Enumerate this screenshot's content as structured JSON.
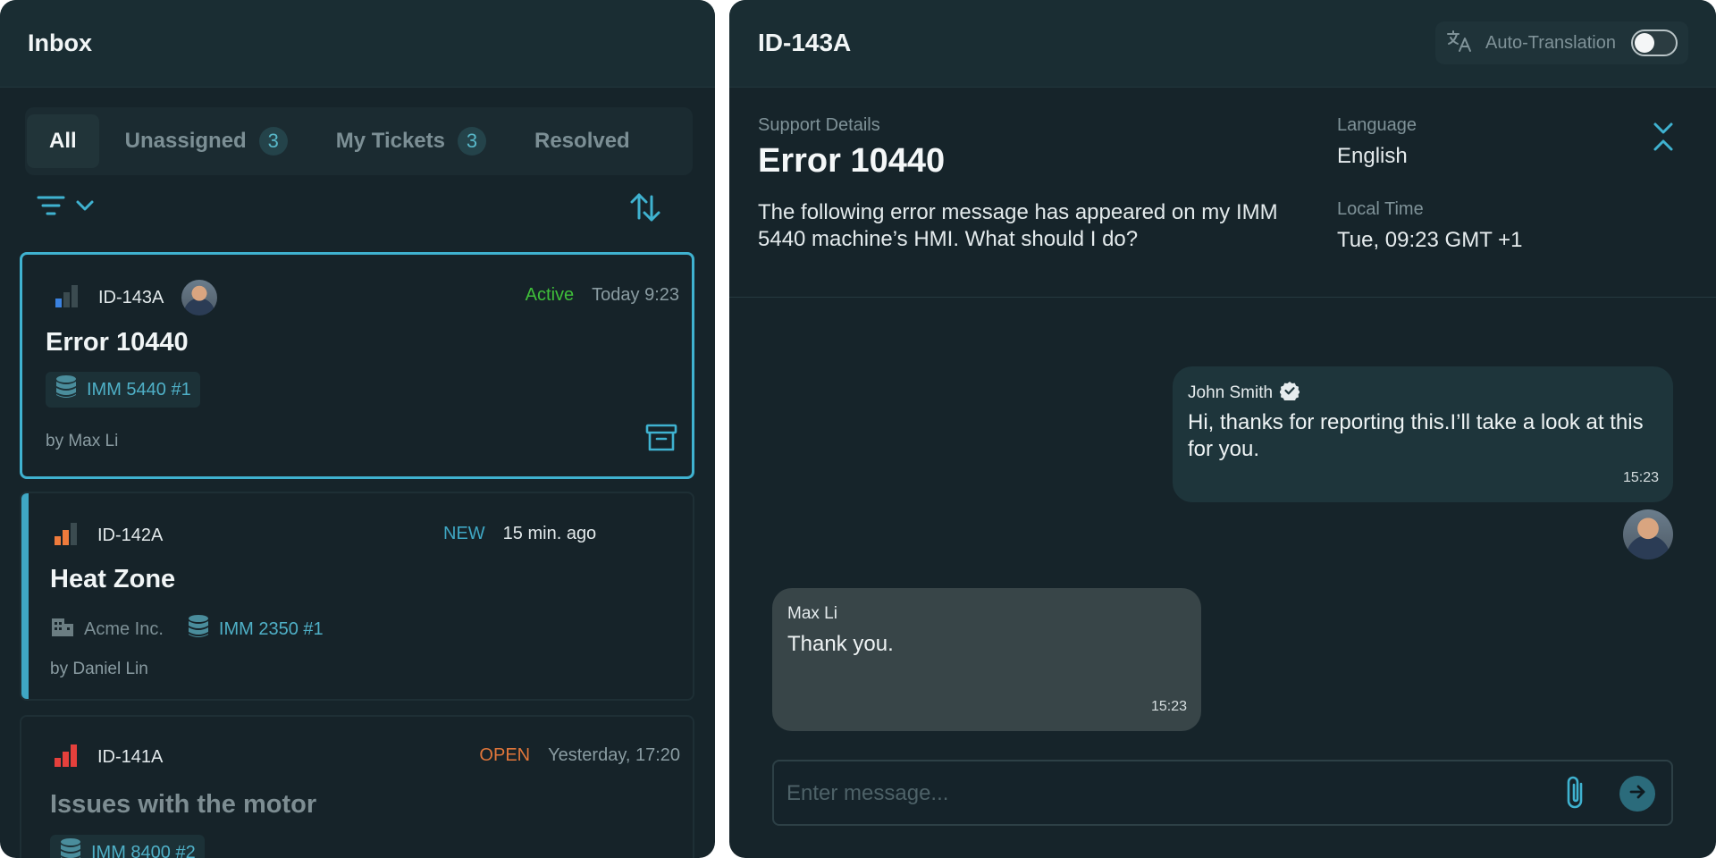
{
  "inbox": {
    "title": "Inbox",
    "tabs": [
      {
        "label": "All",
        "count": null
      },
      {
        "label": "Unassigned",
        "count": "3"
      },
      {
        "label": "My Tickets",
        "count": "3"
      },
      {
        "label": "Resolved",
        "count": null
      }
    ],
    "tickets": [
      {
        "id": "ID-143A",
        "status": "Active",
        "status_color": "#3fbf3a",
        "time": "Today 9:23",
        "title": "Error 10440",
        "machine": "IMM 5440 #1",
        "by": "by Max Li"
      },
      {
        "id": "ID-142A",
        "status": "NEW",
        "status_color": "#3fa7c4",
        "time": "15 min. ago",
        "title": "Heat Zone",
        "company": "Acme Inc.",
        "machine": "IMM 2350 #1",
        "by": "by Daniel Lin"
      },
      {
        "id": "ID-141A",
        "status": "OPEN",
        "status_color": "#e1763a",
        "time": "Yesterday, 17:20",
        "title": "Issues with the motor",
        "machine": "IMM 8400 #2"
      }
    ]
  },
  "chat": {
    "header_id": "ID-143A",
    "auto_translation_label": "Auto-Translation",
    "auto_translation_on": false,
    "details": {
      "section_label": "Support Details",
      "title": "Error 10440",
      "description": "The following error message has appeared on my IMM 5440 machine’s HMI. What should I do?",
      "language_label": "Language",
      "language_value": "English",
      "local_time_label": "Local Time",
      "local_time_value": "Tue, 09:23 GMT +1"
    },
    "messages": [
      {
        "sender": "John Smith",
        "verified": true,
        "text": "Hi, thanks for reporting this.I’ll take a look at this for you.",
        "time": "15:23"
      },
      {
        "sender": "Max Li",
        "text": "Thank you.",
        "time": "15:23"
      }
    ],
    "composer_placeholder": "Enter message..."
  },
  "colors": {
    "accent": "#3fb2d0",
    "panel_bg": "#16242a",
    "priority_low": "#3b82e0",
    "priority_medium": "#ef7b3c",
    "priority_high": "#e5403c"
  }
}
